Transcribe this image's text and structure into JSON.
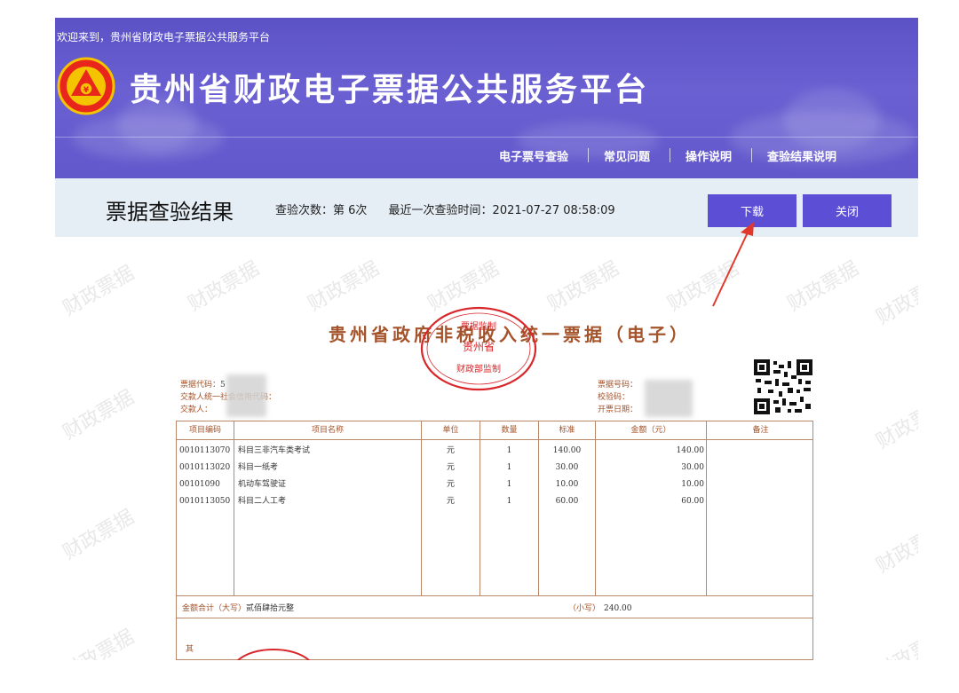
{
  "header": {
    "welcome_text": "欢迎来到，贵州省财政电子票据公共服务平台",
    "site_title": "贵州省财政电子票据公共服务平台",
    "nav": [
      {
        "label": "电子票号查验"
      },
      {
        "label": "常见问题"
      },
      {
        "label": "操作说明"
      },
      {
        "label": "查验结果说明"
      }
    ]
  },
  "result": {
    "title": "票据查验结果",
    "check_count_text": "查验次数：第 6次",
    "last_check_text": "最近一次查验时间：2021-07-27 08:58:09",
    "download_label": "下载",
    "close_label": "关闭"
  },
  "watermark_text": "财政票据",
  "receipt": {
    "title": "贵州省政府非税收入统一票据（电子）",
    "seal_top": "票据监制",
    "seal_middle": "贵州省",
    "seal_bottom": "财政部监制",
    "left_fields": [
      {
        "label": "票据代码：",
        "value": "5"
      },
      {
        "label": "交款人统一社会信用代码：",
        "value": ""
      },
      {
        "label": "交款人：",
        "value": ""
      }
    ],
    "right_fields": [
      {
        "label": "票据号码：",
        "value": ""
      },
      {
        "label": "校验码：",
        "value": ""
      },
      {
        "label": "开票日期：",
        "value": ""
      }
    ],
    "columns": [
      "项目编码",
      "项目名称",
      "单位",
      "数量",
      "标准",
      "金额（元）",
      "备注"
    ],
    "items": [
      {
        "code": "0010113070",
        "name": "科目三非汽车类考试",
        "unit": "元",
        "qty": "1",
        "standard": "140.00",
        "amount": "140.00",
        "note": ""
      },
      {
        "code": "0010113020",
        "name": "科目一纸考",
        "unit": "元",
        "qty": "1",
        "standard": "30.00",
        "amount": "30.00",
        "note": ""
      },
      {
        "code": "00101090",
        "name": "机动车驾驶证",
        "unit": "元",
        "qty": "1",
        "standard": "10.00",
        "amount": "10.00",
        "note": ""
      },
      {
        "code": "0010113050",
        "name": "科目二人工考",
        "unit": "元",
        "qty": "1",
        "standard": "60.00",
        "amount": "60.00",
        "note": ""
      }
    ],
    "total_label": "金额合计（大写）",
    "total_in_words": "贰佰肆拾元整",
    "total_small_label": "（小写）",
    "total_small": "240.00",
    "other_label": "其"
  },
  "colors": {
    "banner": "#6258cc",
    "button": "#5c4fd6",
    "receipt_accent": "#a4532a",
    "arrow": "#e0392b"
  }
}
